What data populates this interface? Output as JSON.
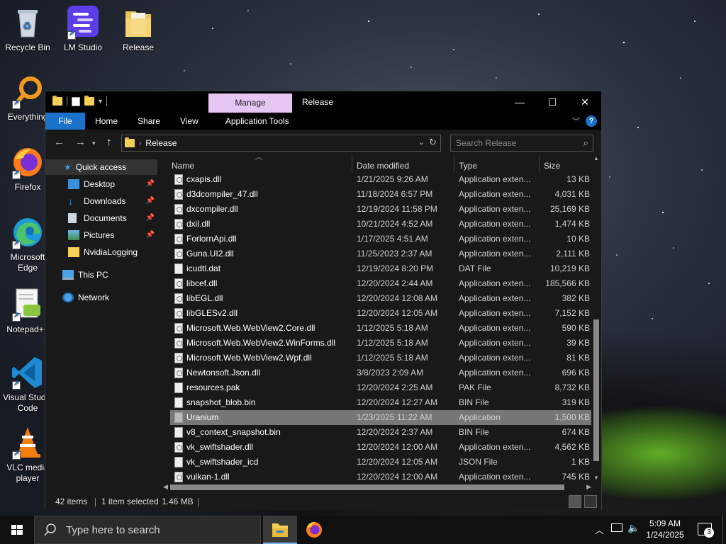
{
  "desktop": {
    "icons": [
      {
        "label": "Recycle Bin"
      },
      {
        "label": "LM Studio"
      },
      {
        "label": "Release"
      },
      {
        "label": "Everything"
      },
      {
        "label": "Firefox"
      },
      {
        "label": "Microsoft Edge"
      },
      {
        "label": "Notepad++"
      },
      {
        "label": "Visual Studio Code"
      },
      {
        "label": "VLC media player"
      }
    ]
  },
  "window": {
    "title": "Release",
    "manage_tab": "Manage",
    "ribbon_tabs": [
      "File",
      "Home",
      "Share",
      "View",
      "Application Tools"
    ],
    "controls": {
      "minimize": "—",
      "maximize": "☐",
      "close": "✕"
    },
    "help": "?"
  },
  "navbar": {
    "address_crumb": "Release",
    "search_placeholder": "Search Release"
  },
  "nav_pane": {
    "quick_access": "Quick access",
    "items": [
      {
        "label": "Desktop",
        "pinned": true
      },
      {
        "label": "Downloads",
        "pinned": true
      },
      {
        "label": "Documents",
        "pinned": true
      },
      {
        "label": "Pictures",
        "pinned": true
      },
      {
        "label": "NvidiaLogging",
        "pinned": false
      }
    ],
    "this_pc": "This PC",
    "network": "Network"
  },
  "columns": [
    "Name",
    "Date modified",
    "Type",
    "Size"
  ],
  "files": [
    {
      "name": "cxapis.dll",
      "date": "1/21/2025 9:26 AM",
      "type": "Application exten...",
      "size": "13 KB",
      "icon": "dll"
    },
    {
      "name": "d3dcompiler_47.dll",
      "date": "11/18/2024 6:57 PM",
      "type": "Application exten...",
      "size": "4,031 KB",
      "icon": "dll"
    },
    {
      "name": "dxcompiler.dll",
      "date": "12/19/2024 11:58 PM",
      "type": "Application exten...",
      "size": "25,169 KB",
      "icon": "dll"
    },
    {
      "name": "dxil.dll",
      "date": "10/21/2024 4:52 AM",
      "type": "Application exten...",
      "size": "1,474 KB",
      "icon": "dll"
    },
    {
      "name": "ForlornApi.dll",
      "date": "1/17/2025 4:51 AM",
      "type": "Application exten...",
      "size": "10 KB",
      "icon": "dll"
    },
    {
      "name": "Guna.UI2.dll",
      "date": "11/25/2023 2:37 AM",
      "type": "Application exten...",
      "size": "2,111 KB",
      "icon": "dll"
    },
    {
      "name": "icudtl.dat",
      "date": "12/19/2024 8:20 PM",
      "type": "DAT File",
      "size": "10,219 KB",
      "icon": "file"
    },
    {
      "name": "libcef.dll",
      "date": "12/20/2024 2:44 AM",
      "type": "Application exten...",
      "size": "185,566 KB",
      "icon": "dll"
    },
    {
      "name": "libEGL.dll",
      "date": "12/20/2024 12:08 AM",
      "type": "Application exten...",
      "size": "382 KB",
      "icon": "dll"
    },
    {
      "name": "libGLESv2.dll",
      "date": "12/20/2024 12:05 AM",
      "type": "Application exten...",
      "size": "7,152 KB",
      "icon": "dll"
    },
    {
      "name": "Microsoft.Web.WebView2.Core.dll",
      "date": "1/12/2025 5:18 AM",
      "type": "Application exten...",
      "size": "590 KB",
      "icon": "dll"
    },
    {
      "name": "Microsoft.Web.WebView2.WinForms.dll",
      "date": "1/12/2025 5:18 AM",
      "type": "Application exten...",
      "size": "39 KB",
      "icon": "dll"
    },
    {
      "name": "Microsoft.Web.WebView2.Wpf.dll",
      "date": "1/12/2025 5:18 AM",
      "type": "Application exten...",
      "size": "81 KB",
      "icon": "dll"
    },
    {
      "name": "Newtonsoft.Json.dll",
      "date": "3/8/2023 2:09 AM",
      "type": "Application exten...",
      "size": "696 KB",
      "icon": "dll"
    },
    {
      "name": "resources.pak",
      "date": "12/20/2024 2:25 AM",
      "type": "PAK File",
      "size": "8,732 KB",
      "icon": "file"
    },
    {
      "name": "snapshot_blob.bin",
      "date": "12/20/2024 12:27 AM",
      "type": "BIN File",
      "size": "319 KB",
      "icon": "file"
    },
    {
      "name": "Uranium",
      "date": "1/23/2025 11:22 AM",
      "type": "Application",
      "size": "1,500 KB",
      "icon": "app",
      "selected": true
    },
    {
      "name": "v8_context_snapshot.bin",
      "date": "12/20/2024 2:37 AM",
      "type": "BIN File",
      "size": "674 KB",
      "icon": "file"
    },
    {
      "name": "vk_swiftshader.dll",
      "date": "12/20/2024 12:00 AM",
      "type": "Application exten...",
      "size": "4,562 KB",
      "icon": "dll"
    },
    {
      "name": "vk_swiftshader_icd",
      "date": "12/20/2024 12:05 AM",
      "type": "JSON File",
      "size": "1 KB",
      "icon": "json"
    },
    {
      "name": "vulkan-1.dll",
      "date": "12/20/2024 12:00 AM",
      "type": "Application exten...",
      "size": "745 KB",
      "icon": "dll"
    }
  ],
  "status": {
    "items": "42 items",
    "selected": "1 item selected",
    "size": "1.46 MB"
  },
  "taskbar": {
    "search_placeholder": "Type here to search",
    "time": "5:09 AM",
    "date": "1/24/2025",
    "notifications": "3"
  }
}
